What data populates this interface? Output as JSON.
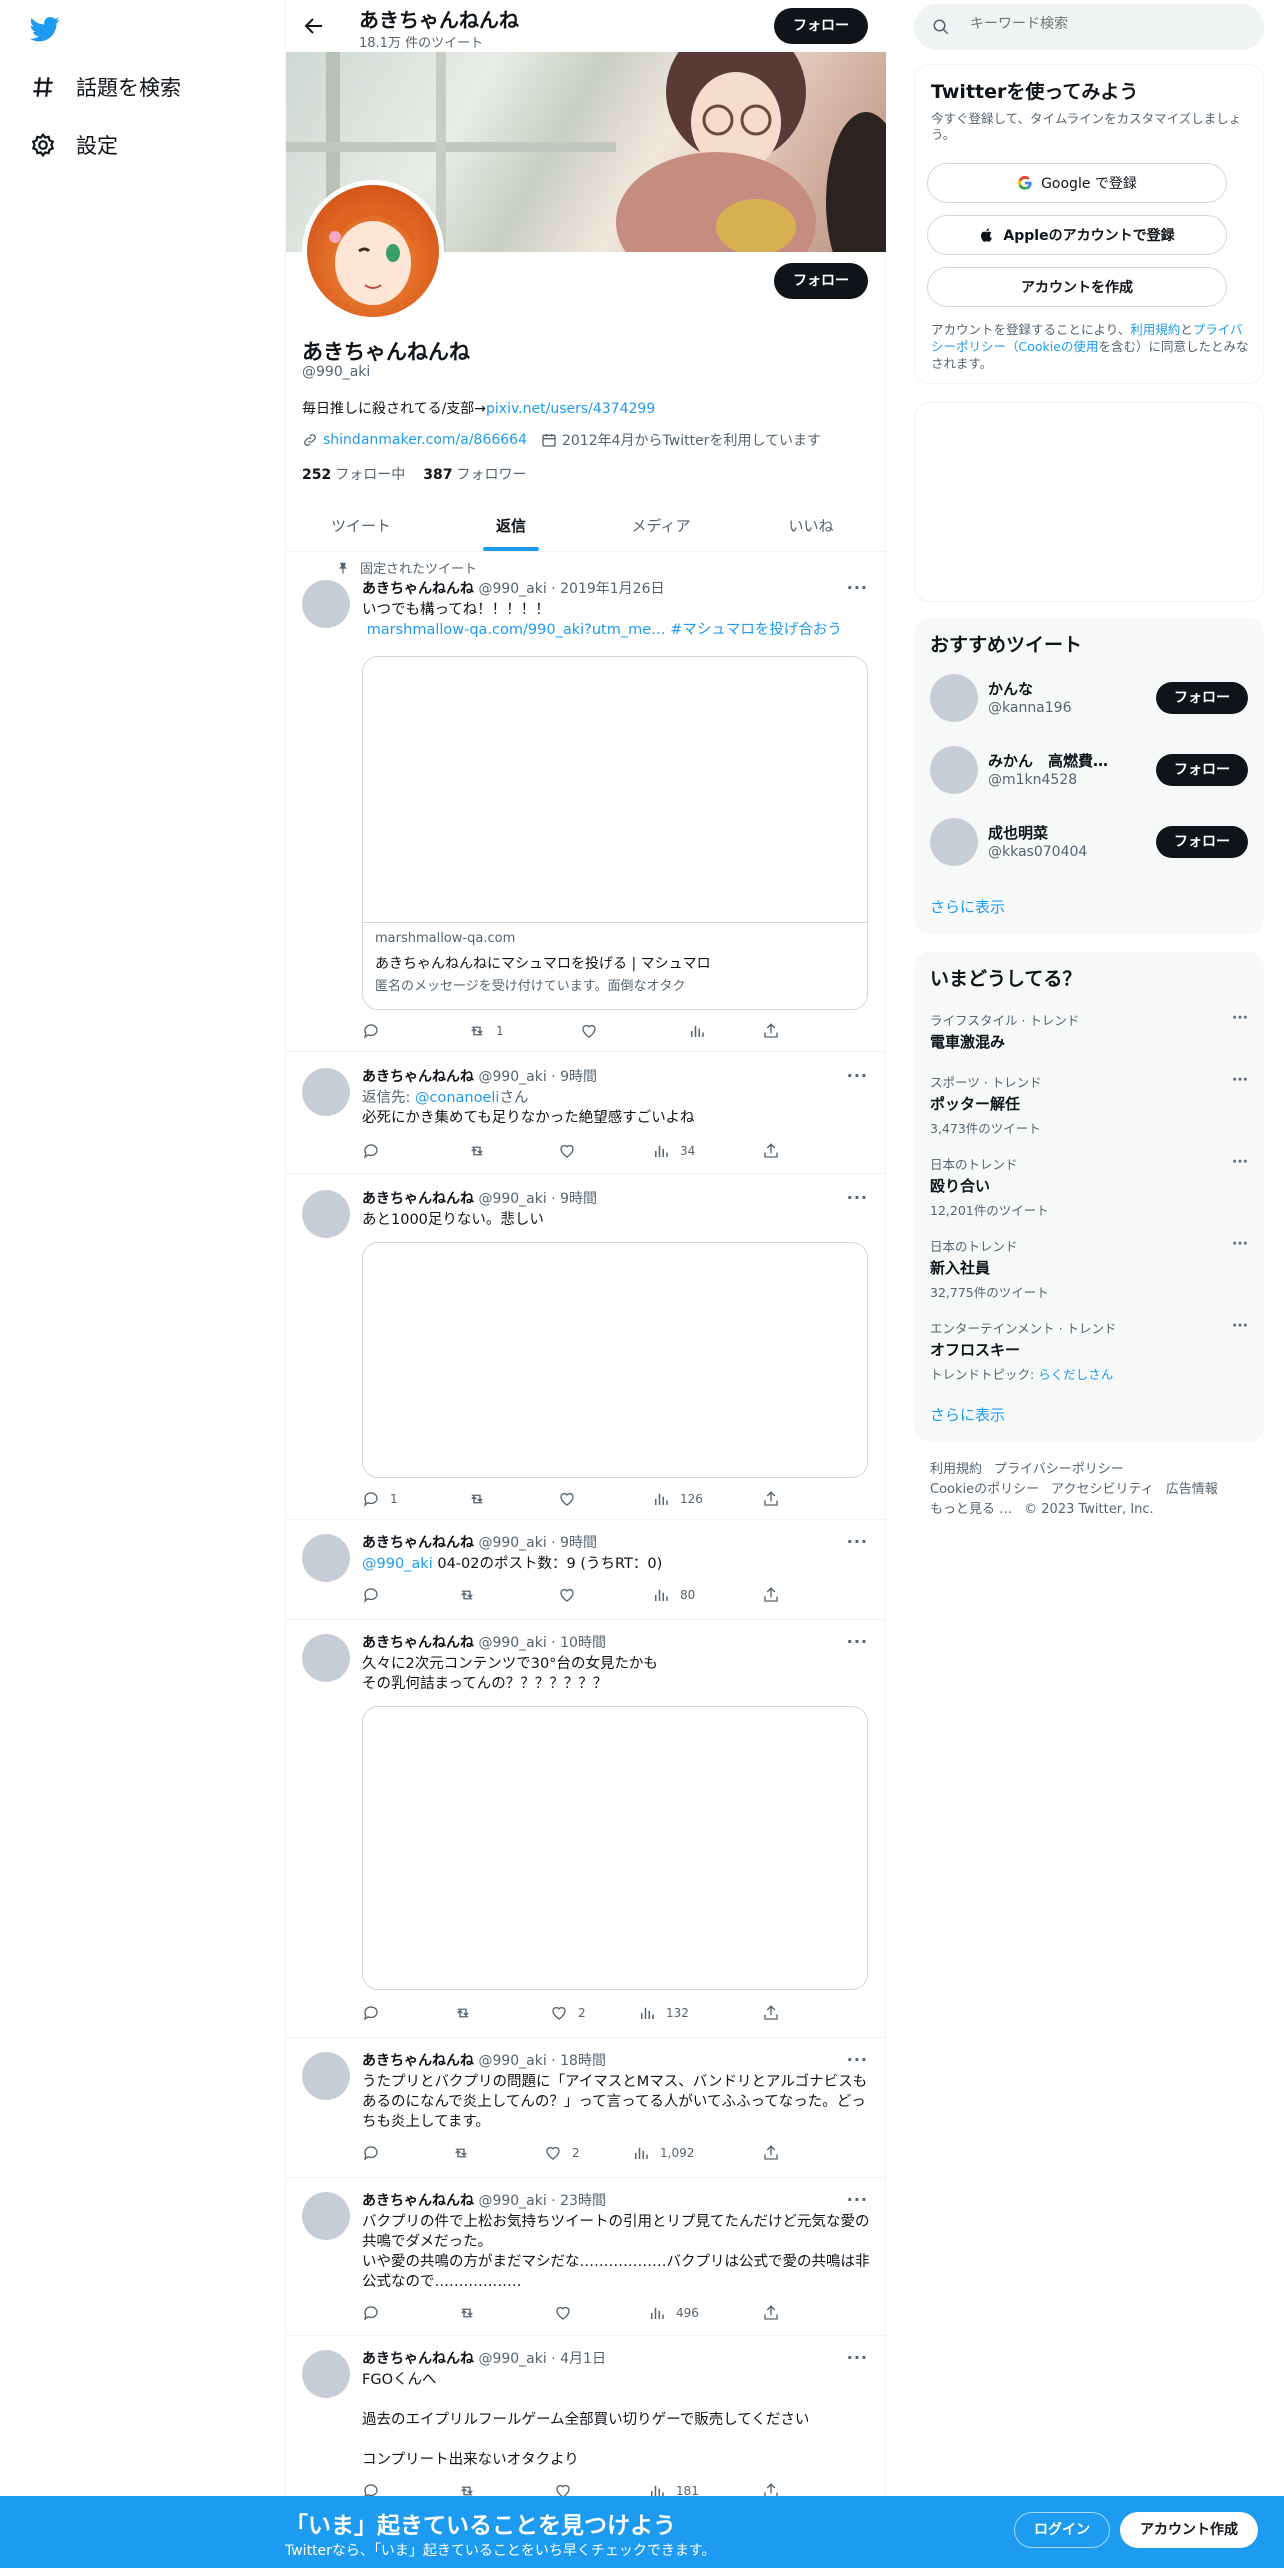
{
  "nav": {
    "logo": "twitter-bird-icon",
    "items": [
      {
        "label": "話題を検索",
        "icon": "hashtag-icon"
      },
      {
        "label": "設定",
        "icon": "gear-icon"
      }
    ]
  },
  "header": {
    "name": "あきちゃんねんね",
    "tweet_count": "18.1万 件のツイート",
    "follow_label": "フォロー"
  },
  "profile": {
    "name": "あきちゃんねんね",
    "handle": "@990_aki",
    "follow_label": "フォロー",
    "bio_text": "毎日推しに殺されてる/支部→",
    "bio_link": "pixiv.net/users/4374299",
    "website": "shindanmaker.com/a/866664",
    "joined": "2012年4月からTwitterを利用しています",
    "following_count": "252",
    "following_label": "フォロー中",
    "followers_count": "387",
    "followers_label": "フォロワー"
  },
  "tabs": [
    {
      "label": "ツイート",
      "active": false
    },
    {
      "label": "返信",
      "active": true
    },
    {
      "label": "メディア",
      "active": false
    },
    {
      "label": "いいね",
      "active": false
    }
  ],
  "pinned_label": "固定されたツイート",
  "tweets": [
    {
      "name": "あきちゃんねんね",
      "handle": "@990_aki",
      "time": "2019年1月26日",
      "text": "いつでも構ってね！！！！！",
      "link_text": " marshmallow-qa.com/990_aki?utm_me…",
      "hashtag": " #マシュマロを投げ合おう",
      "card_domain": "marshmallow-qa.com",
      "card_title": "あきちゃんねんねにマシュマロを投げる | マシュマロ",
      "card_desc": "匿名のメッセージを受け付けています。面倒なオタク",
      "reply": "",
      "retweet": "1",
      "like": "",
      "views": ""
    },
    {
      "name": "あきちゃんねんね",
      "handle": "@990_aki",
      "time": "9時間",
      "reply_prefix": "返信先: ",
      "reply_to": "@conanoeli",
      "reply_suffix": "さん",
      "text": "必死にかき集めても足りなかった絶望感すごいよね",
      "reply": "",
      "retweet": "",
      "like": "",
      "views": "34"
    },
    {
      "name": "あきちゃんねんね",
      "handle": "@990_aki",
      "time": "9時間",
      "text": "あと1000足りない。悲しい",
      "reply": "1",
      "retweet": "",
      "like": "",
      "views": "126"
    },
    {
      "name": "あきちゃんねんね",
      "handle": "@990_aki",
      "time": "9時間",
      "mention": "@990_aki",
      "text": " 04-02のポスト数：9 (うちRT：0)",
      "reply": "",
      "retweet": "",
      "like": "",
      "views": "80"
    },
    {
      "name": "あきちゃんねんね",
      "handle": "@990_aki",
      "time": "10時間",
      "text": "久々に2次元コンテンツで30°台の女見たかも\nその乳何詰まってんの？？？？？？？",
      "reply": "",
      "retweet": "",
      "like": "2",
      "views": "132"
    },
    {
      "name": "あきちゃんねんね",
      "handle": "@990_aki",
      "time": "18時間",
      "text": "うたプリとバクプリの問題に「アイマスとMマス、バンドリとアルゴナビスもあるのになんで炎上してんの？」って言ってる人がいてふふってなった。どっちも炎上してます。",
      "reply": "",
      "retweet": "",
      "like": "2",
      "views": "1,092"
    },
    {
      "name": "あきちゃんねんね",
      "handle": "@990_aki",
      "time": "23時間",
      "text": "バクプリの件で上松お気持ちツイートの引用とリプ見てたんだけど元気な愛の共鳴でダメだった。\nいや愛の共鳴の方がまだマシだな………………バクプリは公式で愛の共鳴は非公式なので………………",
      "reply": "",
      "retweet": "",
      "like": "",
      "views": "496"
    },
    {
      "name": "あきちゃんねんね",
      "handle": "@990_aki",
      "time": "4月1日",
      "text": "FGOくんへ\n\n過去のエイプリルフールゲーム全部買い切りゲーで販売してください\n\nコンプリート出来ないオタクより",
      "reply": "",
      "retweet": "",
      "like": "",
      "views": "181"
    }
  ],
  "sidebar": {
    "search_placeholder": "キーワード検索",
    "signup": {
      "title": "Twitterを使ってみよう",
      "subtitle": "今すぐ登録して、タイムラインをカスタマイズしましょう。",
      "google_label": "Google で登録",
      "apple_label": "Appleのアカウントで登録",
      "create_label": "アカウントを作成",
      "terms_1": "アカウントを登録することにより、",
      "terms_link1": "利用規約",
      "terms_2": "と",
      "terms_link2": "プライバシーポリシー（Cookieの使用",
      "terms_3": "を含む）に同意したとみなされます。"
    },
    "recommend": {
      "title": "おすすめツイート",
      "users": [
        {
          "name": "かんな",
          "handle": "@kanna196",
          "follow": "フォロー"
        },
        {
          "name": "みかん　高燃費…",
          "handle": "@m1kn4528",
          "follow": "フォロー"
        },
        {
          "name": "成也明菜",
          "handle": "@kkas070404",
          "follow": "フォロー"
        }
      ],
      "more": "さらに表示"
    },
    "trends": {
      "title": "いまどうしてる？",
      "items": [
        {
          "category": "ライフスタイル · トレンド",
          "name": "電車激混み",
          "count": ""
        },
        {
          "category": "スポーツ · トレンド",
          "name": "ポッター解任",
          "count": "3,473件のツイート"
        },
        {
          "category": "日本のトレンド",
          "name": "殴り合い",
          "count": "12,201件のツイート"
        },
        {
          "category": "日本のトレンド",
          "name": "新入社員",
          "count": "32,775件のツイート"
        },
        {
          "category": "エンターテインメント · トレンド",
          "name": "オフロスキー",
          "count": "",
          "topic_prefix": "トレンドトピック: ",
          "topic": "らくだしさん"
        }
      ],
      "more": "さらに表示"
    },
    "footer": {
      "links": [
        "利用規約",
        "プライバシーポリシー",
        "Cookieのポリシー",
        "アクセシビリティ",
        "広告情報",
        "もっと見る …"
      ],
      "copyright": "© 2023 Twitter, Inc."
    }
  },
  "bottom_bar": {
    "headline": "「いま」起きていることを見つけよう",
    "sub": "Twitterなら、「いま」起きていることをいち早くチェックできます。",
    "login": "ログイン",
    "signup": "アカウント作成"
  }
}
